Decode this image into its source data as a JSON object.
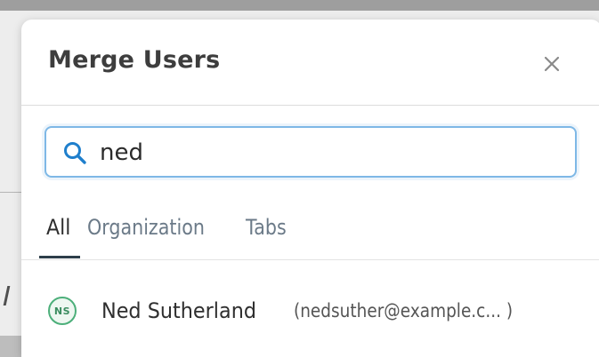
{
  "dialog": {
    "title": "Merge Users",
    "close_icon": "close-icon"
  },
  "search": {
    "icon": "search-icon",
    "value": "ned",
    "placeholder": ""
  },
  "tabs": [
    {
      "label": "All",
      "active": true
    },
    {
      "label": "Organization",
      "active": false
    },
    {
      "label": "Tabs",
      "active": false
    }
  ],
  "results": [
    {
      "initials": "NS",
      "name": "Ned Sutherland",
      "email": "(nedsuther@example.c... )"
    }
  ],
  "colors": {
    "title": "#3d3d3d",
    "search_border": "#7eb8e6",
    "search_icon": "#1f7fcc",
    "tab_active_underline": "#2d3e4a",
    "tab_inactive": "#6b7a88",
    "avatar_border": "#4caf7a"
  }
}
